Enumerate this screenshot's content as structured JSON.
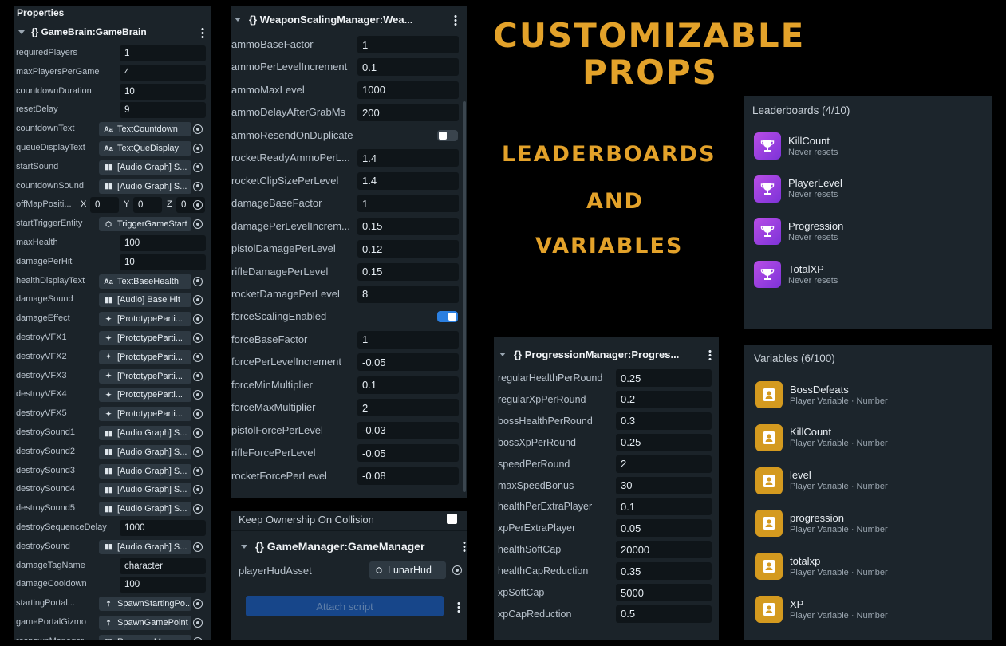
{
  "gamebrain": {
    "section": "Properties",
    "title": "{} GameBrain:GameBrain",
    "rows": [
      {
        "label": "requiredPlayers",
        "type": "value",
        "value": "1"
      },
      {
        "label": "maxPlayersPerGame",
        "type": "value",
        "value": "4"
      },
      {
        "label": "countdownDuration",
        "type": "value",
        "value": "10"
      },
      {
        "label": "resetDelay",
        "type": "value",
        "value": "9"
      },
      {
        "label": "countdownText",
        "type": "ref",
        "icon": "Aa",
        "value": "TextCountdown"
      },
      {
        "label": "queueDisplayText",
        "type": "ref",
        "icon": "Aa",
        "value": "TextQueDisplay"
      },
      {
        "label": "startSound",
        "type": "ref",
        "icon": "audio",
        "value": "[Audio Graph] S..."
      },
      {
        "label": "countdownSound",
        "type": "ref",
        "icon": "audio",
        "value": "[Audio Graph] S..."
      },
      {
        "label": "offMapPositi...",
        "type": "vec3",
        "x": "0",
        "y": "0",
        "z": "0"
      },
      {
        "label": "startTriggerEntity",
        "type": "ref",
        "icon": "cube",
        "value": "TriggerGameStart"
      },
      {
        "label": "maxHealth",
        "type": "value",
        "value": "100"
      },
      {
        "label": "damagePerHit",
        "type": "value",
        "value": "10"
      },
      {
        "label": "healthDisplayText",
        "type": "ref",
        "icon": "Aa",
        "value": "TextBaseHealth"
      },
      {
        "label": "damageSound",
        "type": "ref",
        "icon": "audio",
        "value": "[Audio] Base Hit"
      },
      {
        "label": "damageEffect",
        "type": "ref",
        "icon": "sparkle",
        "value": "[PrototypeParti..."
      },
      {
        "label": "destroyVFX1",
        "type": "ref",
        "icon": "sparkle",
        "value": "[PrototypeParti..."
      },
      {
        "label": "destroyVFX2",
        "type": "ref",
        "icon": "sparkle",
        "value": "[PrototypeParti..."
      },
      {
        "label": "destroyVFX3",
        "type": "ref",
        "icon": "sparkle",
        "value": "[PrototypeParti..."
      },
      {
        "label": "destroyVFX4",
        "type": "ref",
        "icon": "sparkle",
        "value": "[PrototypeParti..."
      },
      {
        "label": "destroyVFX5",
        "type": "ref",
        "icon": "sparkle",
        "value": "[PrototypeParti..."
      },
      {
        "label": "destroySound1",
        "type": "ref",
        "icon": "audio",
        "value": "[Audio Graph] S..."
      },
      {
        "label": "destroySound2",
        "type": "ref",
        "icon": "audio",
        "value": "[Audio Graph] S..."
      },
      {
        "label": "destroySound3",
        "type": "ref",
        "icon": "audio",
        "value": "[Audio Graph] S..."
      },
      {
        "label": "destroySound4",
        "type": "ref",
        "icon": "audio",
        "value": "[Audio Graph] S..."
      },
      {
        "label": "destroySound5",
        "type": "ref",
        "icon": "audio",
        "value": "[Audio Graph] S..."
      },
      {
        "label": "destroySequenceDelay",
        "type": "value",
        "value": "1000"
      },
      {
        "label": "destroySound",
        "type": "ref",
        "icon": "audio",
        "value": "[Audio Graph] S..."
      },
      {
        "label": "damageTagName",
        "type": "value",
        "value": "character"
      },
      {
        "label": "damageCooldown",
        "type": "value",
        "value": "100"
      },
      {
        "label": "startingPortal...",
        "type": "ref",
        "icon": "person",
        "value": "SpawnStartingPo..."
      },
      {
        "label": "gamePortalGizmo",
        "type": "ref",
        "icon": "person",
        "value": "SpawnGamePoint"
      },
      {
        "label": "respawnManager",
        "type": "ref",
        "icon": "frame",
        "value": "RespawnManager"
      }
    ]
  },
  "weapon": {
    "title": "{} WeaponScalingManager:Wea...",
    "rows": [
      {
        "label": "ammoBaseFactor",
        "type": "value",
        "value": "1"
      },
      {
        "label": "ammoPerLevelIncrement",
        "type": "value",
        "value": "0.1"
      },
      {
        "label": "ammoMaxLevel",
        "type": "value",
        "value": "1000"
      },
      {
        "label": "ammoDelayAfterGrabMs",
        "type": "value",
        "value": "200"
      },
      {
        "label": "ammoResendOnDuplicate",
        "type": "toggle",
        "on": false
      },
      {
        "label": "rocketReadyAmmoPerL...",
        "type": "value",
        "value": "1.4"
      },
      {
        "label": "rocketClipSizePerLevel",
        "type": "value",
        "value": "1.4"
      },
      {
        "label": "damageBaseFactor",
        "type": "value",
        "value": "1"
      },
      {
        "label": "damagePerLevelIncrem...",
        "type": "value",
        "value": "0.15"
      },
      {
        "label": "pistolDamagePerLevel",
        "type": "value",
        "value": "0.12"
      },
      {
        "label": "rifleDamagePerLevel",
        "type": "value",
        "value": "0.15"
      },
      {
        "label": "rocketDamagePerLevel",
        "type": "value",
        "value": "8"
      },
      {
        "label": "forceScalingEnabled",
        "type": "toggle",
        "on": true
      },
      {
        "label": "forceBaseFactor",
        "type": "value",
        "value": "1"
      },
      {
        "label": "forcePerLevelIncrement",
        "type": "value",
        "value": "-0.05"
      },
      {
        "label": "forceMinMultiplier",
        "type": "value",
        "value": "0.1"
      },
      {
        "label": "forceMaxMultiplier",
        "type": "value",
        "value": "2"
      },
      {
        "label": "pistolForcePerLevel",
        "type": "value",
        "value": "-0.03"
      },
      {
        "label": "rifleForcePerLevel",
        "type": "value",
        "value": "-0.05"
      },
      {
        "label": "rocketForcePerLevel",
        "type": "value",
        "value": "-0.08"
      }
    ]
  },
  "gamemanager": {
    "ownership_label": "Keep Ownership On Collision",
    "title": "{} GameManager:GameManager",
    "hud_label": "playerHudAsset",
    "hud_value": "LunarHud",
    "attach_label": "Attach script"
  },
  "titles": {
    "line1": "CUSTOMIZABLE",
    "line2": "PROPS",
    "line3": "LEADERBOARDS",
    "line4": "AND",
    "line5": "VARIABLES"
  },
  "progression": {
    "title": "{} ProgressionManager:Progres...",
    "rows": [
      {
        "label": "regularHealthPerRound",
        "value": "0.25"
      },
      {
        "label": "regularXpPerRound",
        "value": "0.2"
      },
      {
        "label": "bossHealthPerRound",
        "value": "0.3"
      },
      {
        "label": "bossXpPerRound",
        "value": "0.25"
      },
      {
        "label": "speedPerRound",
        "value": "2"
      },
      {
        "label": "maxSpeedBonus",
        "value": "30"
      },
      {
        "label": "healthPerExtraPlayer",
        "value": "0.1"
      },
      {
        "label": "xpPerExtraPlayer",
        "value": "0.05"
      },
      {
        "label": "healthSoftCap",
        "value": "20000"
      },
      {
        "label": "healthCapReduction",
        "value": "0.35"
      },
      {
        "label": "xpSoftCap",
        "value": "5000"
      },
      {
        "label": "xpCapReduction",
        "value": "0.5"
      }
    ]
  },
  "leaderboards": {
    "title": "Leaderboards (4/10)",
    "items": [
      {
        "name": "KillCount",
        "sub": "Never resets"
      },
      {
        "name": "PlayerLevel",
        "sub": "Never resets"
      },
      {
        "name": "Progression",
        "sub": "Never resets"
      },
      {
        "name": "TotalXP",
        "sub": "Never resets"
      }
    ]
  },
  "variables": {
    "title": "Variables (6/100)",
    "items": [
      {
        "name": "BossDefeats",
        "sub": "Player Variable · Number"
      },
      {
        "name": "KillCount",
        "sub": "Player Variable · Number"
      },
      {
        "name": "level",
        "sub": "Player Variable · Number"
      },
      {
        "name": "progression",
        "sub": "Player Variable · Number"
      },
      {
        "name": "totalxp",
        "sub": "Player Variable · Number"
      },
      {
        "name": "XP",
        "sub": "Player Variable · Number"
      }
    ]
  },
  "colors": {
    "accent": "#e3a22a",
    "panel": "#1b2329",
    "field": "#0f1519",
    "toggle_on": "#2b7fe0",
    "leaderboard_icon": "#9b42df",
    "variable_icon": "#d49a1f"
  }
}
